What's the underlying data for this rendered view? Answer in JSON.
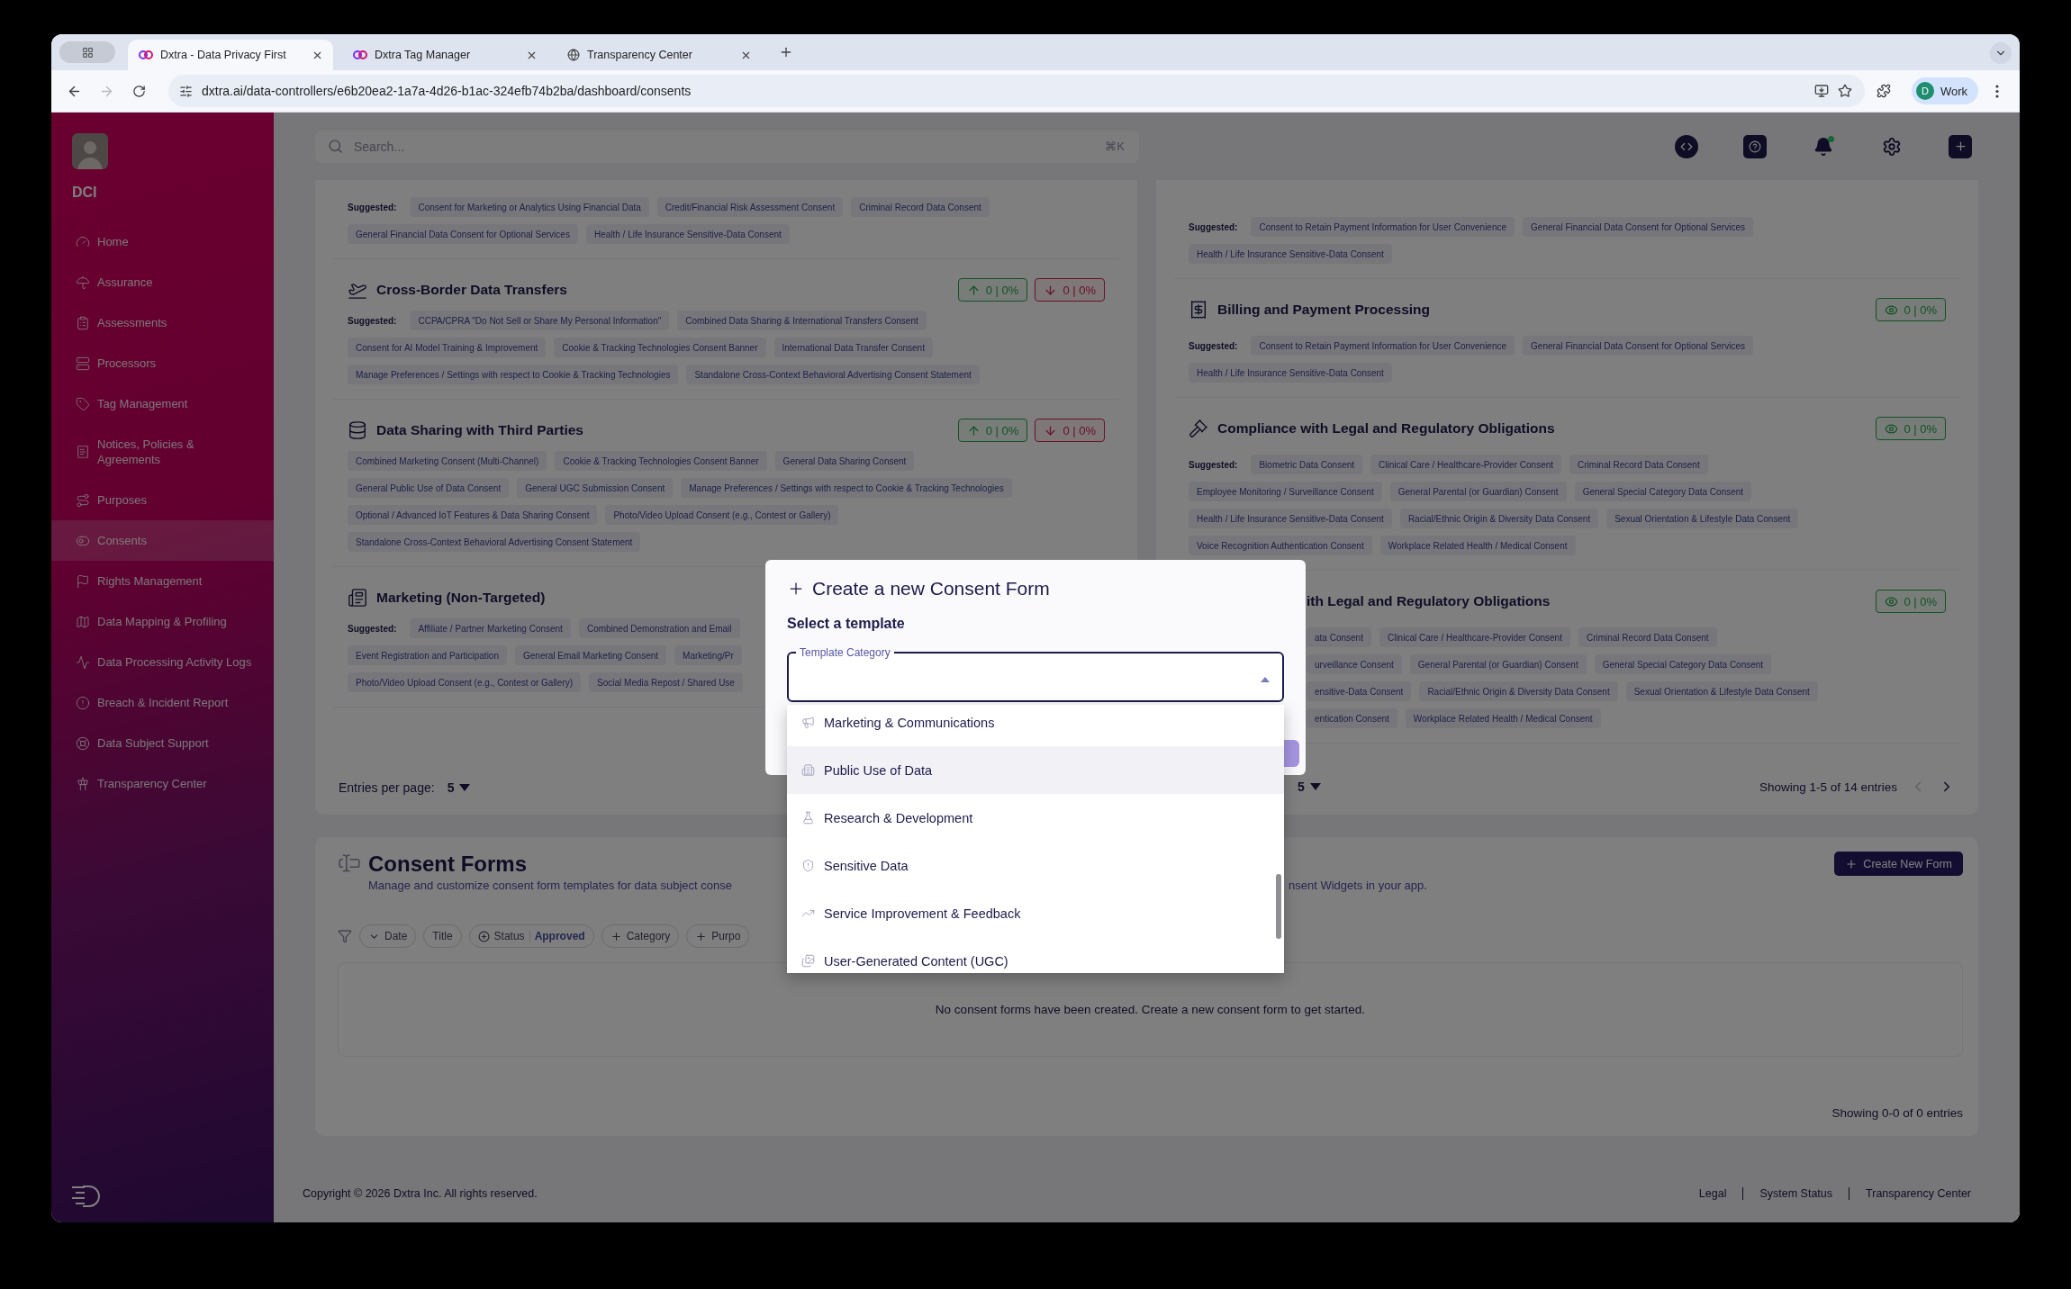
{
  "browser": {
    "tabs": [
      {
        "title": "Dxtra - Data Privacy First",
        "selected": true
      },
      {
        "title": "Dxtra Tag Manager",
        "selected": false
      },
      {
        "title": "Transparency Center",
        "selected": false
      }
    ],
    "back_disabled": false,
    "forward_disabled": true,
    "url": "dxtra.ai/data-controllers/e6b20ea2-1a7a-4d26-b1ac-324efb74b2ba/dashboard/consents",
    "profile": {
      "initial": "D",
      "label": "Work"
    }
  },
  "sidebar": {
    "org": "DCI",
    "items": [
      {
        "label": "Home",
        "selected": false
      },
      {
        "label": "Assurance",
        "selected": false
      },
      {
        "label": "Assessments",
        "selected": false
      },
      {
        "label": "Processors",
        "selected": false
      },
      {
        "label": "Tag Management",
        "selected": false
      },
      {
        "label": "Notices, Policies & Agreements",
        "selected": false
      },
      {
        "label": "Purposes",
        "selected": false
      },
      {
        "label": "Consents",
        "selected": true
      },
      {
        "label": "Rights Management",
        "selected": false
      },
      {
        "label": "Data Mapping & Profiling",
        "selected": false
      },
      {
        "label": "Data Processing Activity Logs",
        "selected": false
      },
      {
        "label": "Breach & Incident Report",
        "selected": false
      },
      {
        "label": "Data Subject Support",
        "selected": false
      },
      {
        "label": "Transparency Center",
        "selected": false
      }
    ]
  },
  "header": {
    "search": {
      "placeholder": "Search...",
      "shortcut": "⌘K"
    },
    "notifications_unread": true
  },
  "purposes": {
    "columns": [
      {
        "items": [
          {
            "kind": "continued",
            "label": "Suggested:",
            "rows": [
              [
                "Consent for Marketing or Analytics Using Financial Data",
                "Credit/Financial Risk Assessment Consent",
                "Criminal Record Data Consent"
              ],
              [
                "General Financial Data Consent for Optional Services",
                "Health / Life Insurance Sensitive-Data Consent"
              ]
            ]
          },
          {
            "kind": "full",
            "title": "Cross-Border Data Transfers",
            "badges": [
              {
                "kind": "up",
                "text": "0 | 0%"
              },
              {
                "kind": "down",
                "text": "0 | 0%"
              }
            ],
            "label": "Suggested:",
            "rows": [
              [
                "CCPA/CPRA \"Do Not Sell or Share My Personal Information\"",
                "Combined Data Sharing & International Transfers Consent"
              ],
              [
                "Consent for AI Model Training & Improvement",
                "Cookie & Tracking Technologies Consent Banner",
                "International Data Transfer Consent"
              ],
              [
                "Manage Preferences / Settings with respect to Cookie & Tracking Technologies",
                "Standalone Cross-Context Behavioral Advertising Consent Statement"
              ]
            ]
          },
          {
            "kind": "full",
            "title": "Data Sharing with Third Parties",
            "badges": [
              {
                "kind": "up",
                "text": "0 | 0%"
              },
              {
                "kind": "down",
                "text": "0 | 0%"
              }
            ],
            "rows": [
              [
                "Combined Marketing Consent (Multi-Channel)",
                "Cookie & Tracking Technologies Consent Banner",
                "General Data Sharing Consent"
              ],
              [
                "General Public Use of Data Consent",
                "General UGC Submission Consent",
                "Manage Preferences / Settings with respect to Cookie & Tracking Technologies"
              ],
              [
                "Optional / Advanced IoT Features & Data Sharing Consent",
                "Photo/Video Upload Consent (e.g., Contest or Gallery)"
              ],
              [
                "Standalone Cross-Context Behavioral Advertising Consent Statement"
              ]
            ]
          },
          {
            "kind": "full",
            "title": "Marketing (Non-Targeted)",
            "label": "Suggested:",
            "rows": [
              [
                "Affiliate / Partner Marketing Consent",
                "Combined Demonstration and Email"
              ],
              [
                "Event Registration and Participation",
                "General Email Marketing Consent",
                "Marketing/Pr"
              ],
              [
                "Photo/Video Upload Consent (e.g., Contest or Gallery)",
                "Social Media Repost / Shared Use"
              ]
            ]
          }
        ],
        "pagination": {
          "label": "Entries per page:",
          "value": "5"
        }
      },
      {
        "items": [
          {
            "kind": "continued",
            "label": "Suggested:",
            "rows": [
              [
                "Consent to Retain Payment Information for User Convenience",
                "General Financial Data Consent for Optional Services"
              ],
              [
                "Health / Life Insurance Sensitive-Data Consent"
              ]
            ]
          },
          {
            "kind": "full",
            "title": "Billing and Payment Processing",
            "badges": [
              {
                "kind": "views",
                "text": "0 | 0%"
              }
            ],
            "label": "Suggested:",
            "rows": [
              [
                "Consent to Retain Payment Information for User Convenience",
                "General Financial Data Consent for Optional Services"
              ],
              [
                "Health / Life Insurance Sensitive-Data Consent"
              ]
            ]
          },
          {
            "kind": "full",
            "title": "Compliance with Legal and Regulatory Obligations",
            "badges": [
              {
                "kind": "views",
                "text": "0 | 0%"
              }
            ],
            "label": "Suggested:",
            "rows": [
              [
                "Biometric Data Consent",
                "Clinical Care / Healthcare-Provider Consent",
                "Criminal Record Data Consent"
              ],
              [
                "Employee Monitoring / Surveillance Consent",
                "General Parental (or Guardian) Consent",
                "General Special Category Data Consent"
              ],
              [
                "Health / Life Insurance Sensitive-Data Consent",
                "Racial/Ethnic Origin & Diversity Data Consent",
                "Sexual Orientation & Lifestyle Data Consent"
              ],
              [
                "Voice Recognition Authentication Consent",
                "Workplace Related Health / Medical Consent"
              ]
            ]
          },
          {
            "kind": "partial",
            "title": "ith Legal and Regulatory Obligations",
            "badges": [
              {
                "kind": "views",
                "text": "0 | 0%"
              }
            ],
            "rows": [
              [
                "ata Consent",
                "Clinical Care / Healthcare-Provider Consent",
                "Criminal Record Data Consent"
              ],
              [
                "urveillance Consent",
                "General Parental (or Guardian) Consent",
                "General Special Category Data Consent"
              ],
              [
                "ensitive-Data Consent",
                "Racial/Ethnic Origin & Diversity Data Consent",
                "Sexual Orientation & Lifestyle Data Consent"
              ],
              [
                "entication Consent",
                "Workplace Related Health / Medical Consent"
              ]
            ]
          }
        ],
        "pagination": {
          "value": "5",
          "summary": "Showing 1-5 of 14 entries",
          "prev_disabled": true,
          "next_disabled": false
        }
      }
    ]
  },
  "consent_forms": {
    "title": "Consent Forms",
    "description_parts": [
      "Manage and customize consent form templates for data subject conse",
      "nsent Widgets in your app."
    ],
    "create_button": "Create New Form",
    "filters": [
      {
        "kind": "sort",
        "label": "Date"
      },
      {
        "kind": "plain",
        "label": "Title"
      },
      {
        "kind": "status",
        "label": "Status",
        "value": "Approved"
      },
      {
        "kind": "add",
        "label": "Category"
      },
      {
        "kind": "add",
        "label": "Purpo"
      }
    ],
    "empty_message": "No consent forms have been created. Create a new consent form to get started.",
    "summary": "Showing 0-0 of 0 entries"
  },
  "footer": {
    "copyright": "Copyright © 2026 Dxtra Inc. All rights reserved.",
    "links": [
      "Legal",
      "System Status",
      "Transparency Center"
    ]
  },
  "dialog": {
    "title": "Create a new Consent Form",
    "subtitle": "Select a template",
    "field": {
      "label": "Template Category",
      "expanded": true
    },
    "options": [
      {
        "label": "Marketing & Communications",
        "highlighted": false
      },
      {
        "label": "Public Use of Data",
        "highlighted": true
      },
      {
        "label": "Research & Development",
        "highlighted": false
      },
      {
        "label": "Sensitive Data",
        "highlighted": false
      },
      {
        "label": "Service Improvement & Feedback",
        "highlighted": false
      },
      {
        "label": "User-Generated Content (UGC)",
        "highlighted": false
      }
    ]
  }
}
